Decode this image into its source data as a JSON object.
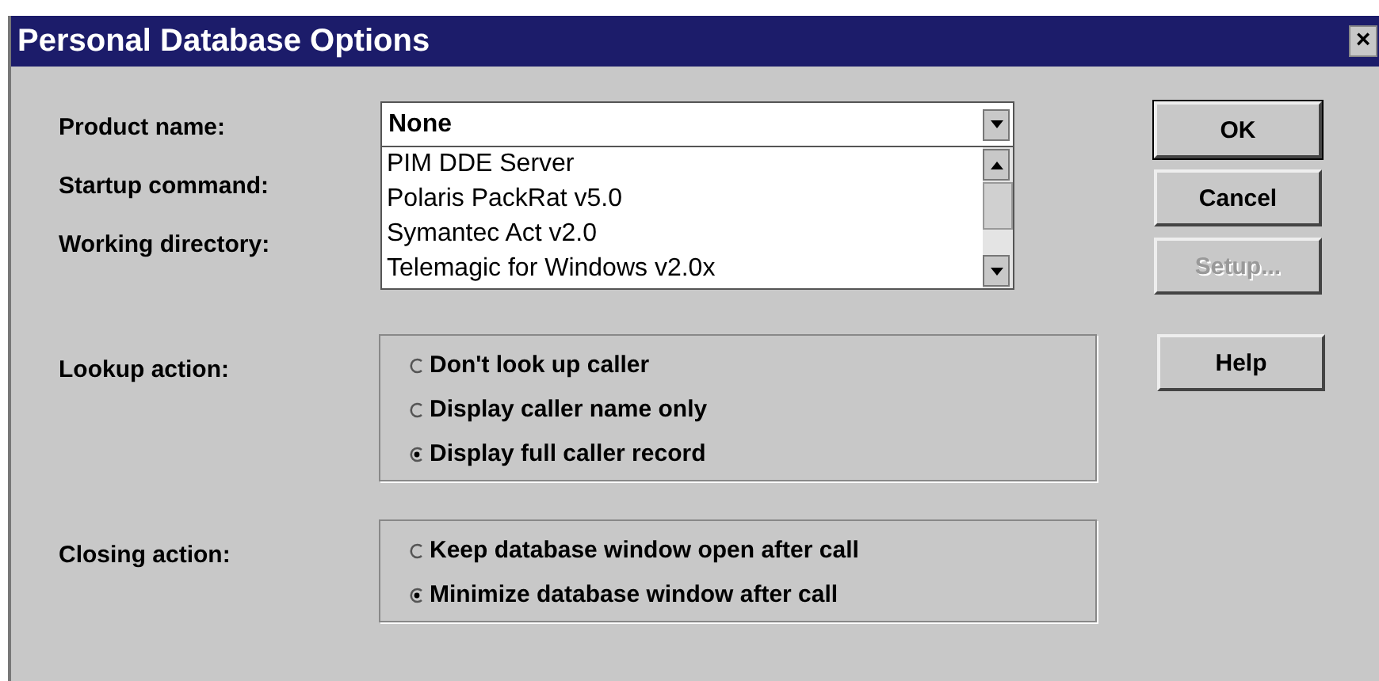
{
  "window": {
    "title": "Personal Database Options",
    "close": "×"
  },
  "fields": [
    {
      "label": "Product name:"
    },
    {
      "label": "Startup command:"
    },
    {
      "label": "Working directory:"
    }
  ],
  "product_combo": {
    "value": "None",
    "expanded": true,
    "options": [
      "PIM DDE Server",
      "Polaris PackRat v5.0",
      "Symantec Act v2.0",
      "Telemagic for Windows v2.0x"
    ]
  },
  "buttons": [
    {
      "label": "OK",
      "disabled": false,
      "default": true
    },
    {
      "label": "Cancel",
      "disabled": false,
      "default": false
    },
    {
      "label": "Setup...",
      "disabled": true,
      "default": false
    }
  ],
  "help_button": {
    "label": "Help"
  },
  "groups": [
    {
      "label": "Lookup action:",
      "options": [
        {
          "label": "Don't look up caller",
          "selected": false
        },
        {
          "label": "Display caller name only",
          "selected": false
        },
        {
          "label": "Display full caller record",
          "selected": true
        }
      ]
    },
    {
      "label": "Closing action:",
      "options": [
        {
          "label": "Keep database window open after call",
          "selected": false
        },
        {
          "label": "Minimize database window after call",
          "selected": true
        }
      ]
    }
  ]
}
